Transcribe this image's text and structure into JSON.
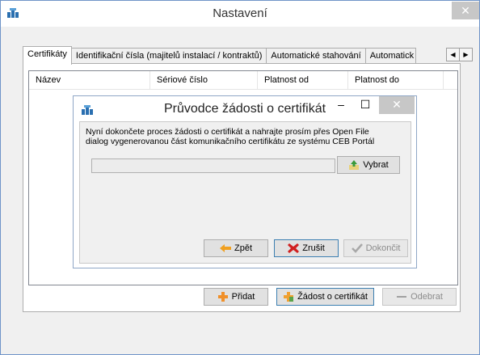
{
  "window": {
    "title": "Nastavení",
    "close_label": "✕"
  },
  "tabs": [
    {
      "label": "Certifikáty"
    },
    {
      "label": "Identifikační čísla (majitelů instalací / kontraktů)"
    },
    {
      "label": "Automatické stahování"
    },
    {
      "label": "Automatick"
    }
  ],
  "list": {
    "columns": [
      "Název",
      "Sériové číslo",
      "Platnost od",
      "Platnost do"
    ]
  },
  "buttons": {
    "add": "Přidat",
    "request": "Žádost o certifikát",
    "remove": "Odebrat"
  },
  "dialog": {
    "title": "Průvodce žádosti o certifikát",
    "message_line1": "Nyní dokončete proces žádosti o certifikát a nahrajte prosím přes Open File",
    "message_line2": "dialog vygenerovanou část komunikačního certifikátu ze systému CEB Portál",
    "file_value": "",
    "browse_label": "Vybrat",
    "back_label": "Zpět",
    "cancel_label": "Zrušit",
    "finish_label": "Dokončit",
    "minimize_label": "–",
    "maximize_label": "☐",
    "close_label": "✕"
  },
  "colors": {
    "accent_border": "#6f94c8",
    "close_bg": "#c7c7c7"
  }
}
